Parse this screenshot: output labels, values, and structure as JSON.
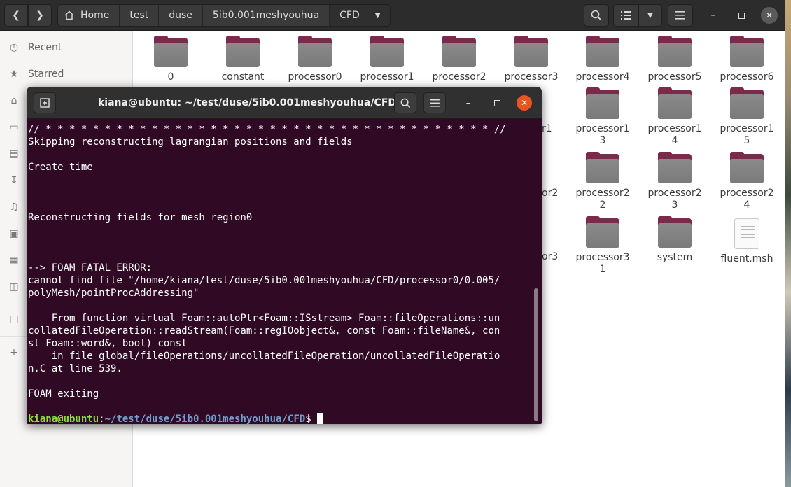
{
  "files": {
    "pathbar": [
      "Home",
      "test",
      "duse",
      "5ib0.001meshyouhua",
      "CFD"
    ],
    "sidebar": [
      {
        "label": "Recent",
        "icon": "clock-icon"
      },
      {
        "label": "Starred",
        "icon": "star-icon"
      },
      {
        "label": "",
        "icon": "home-icon"
      },
      {
        "label": "",
        "icon": "desktop-icon"
      },
      {
        "label": "",
        "icon": "documents-icon"
      },
      {
        "label": "",
        "icon": "downloads-icon"
      },
      {
        "label": "",
        "icon": "music-icon"
      },
      {
        "label": "",
        "icon": "pictures-icon"
      },
      {
        "label": "",
        "icon": "videos-icon"
      },
      {
        "label": "",
        "icon": "trash-icon"
      },
      {
        "label": "",
        "icon": "folder-icon"
      },
      {
        "label": "",
        "icon": "plus-icon"
      }
    ],
    "items": [
      {
        "name": "0"
      },
      {
        "name": "constant"
      },
      {
        "name": "processor0"
      },
      {
        "name": "processor1"
      },
      {
        "name": "processor2"
      },
      {
        "name": "processor3"
      },
      {
        "name": "processor4"
      },
      {
        "name": "processor5"
      },
      {
        "name": "processor6"
      },
      {
        "name": "processor1\n3"
      },
      {
        "name": "processor1\n4"
      },
      {
        "name": "processor1\n5"
      },
      {
        "name": "processor2\n2"
      },
      {
        "name": "processor2\n3"
      },
      {
        "name": "processor2\n4"
      },
      {
        "name": "processor3\n1"
      },
      {
        "name": "system"
      },
      {
        "name": "fluent.msh"
      }
    ],
    "peek_labels": [
      "r1",
      "or2",
      "or3"
    ]
  },
  "terminal": {
    "title": "kiana@ubuntu: ~/test/duse/5ib0.001meshyouhua/CFD",
    "lines": [
      "// * * * * * * * * * * * * * * * * * * * * * * * * * * * * * * * * * * * * * * //",
      "Skipping reconstructing lagrangian positions and fields",
      "",
      "Create time",
      "",
      "",
      "",
      "Reconstructing fields for mesh region0",
      "",
      "",
      "",
      "--> FOAM FATAL ERROR:",
      "cannot find file \"/home/kiana/test/duse/5ib0.001meshyouhua/CFD/processor0/0.005/",
      "polyMesh/pointProcAddressing\"",
      "",
      "    From function virtual Foam::autoPtr<Foam::ISstream> Foam::fileOperations::un",
      "collatedFileOperation::readStream(Foam::regIOobject&, const Foam::fileName&, con",
      "st Foam::word&, bool) const",
      "    in file global/fileOperations/uncollatedFileOperation/uncollatedFileOperatio",
      "n.C at line 539.",
      "",
      "FOAM exiting",
      ""
    ],
    "prompt_user": "kiana@ubuntu",
    "prompt_sep": ":",
    "prompt_path": "~/test/duse/5ib0.001meshyouhua/CFD",
    "prompt_end": "$ "
  },
  "colors": {
    "terminal_bg": "#300a24",
    "prompt_user": "#8ae234",
    "prompt_path": "#729fcf",
    "close_button": "#e95420",
    "folder_tab": "#7a2a4a"
  }
}
